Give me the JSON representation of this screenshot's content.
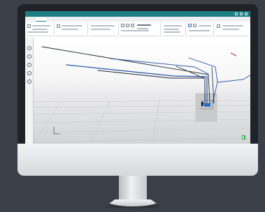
{
  "window": {
    "title": "",
    "ribbon_tabs": [
      "",
      "",
      "",
      "",
      ""
    ],
    "active_tab_index": 1
  },
  "viewport": {
    "corner_label": ""
  },
  "colors": {
    "title_bar": "#1d7e83",
    "pipe_blue": "#2255a0",
    "pipe_dark": "#1c2533",
    "pipe_red": "#d0312d",
    "connector_blue": "#2170c4",
    "status_green": "#2aa84a",
    "page_background": "#3b3f47"
  },
  "icons": {
    "sidebar": [
      "view-front-icon",
      "view-rotate-icon",
      "zoom-icon",
      "pan-icon",
      "settings-icon"
    ],
    "status": "status-green-icon",
    "axis": "axis-triad-icon"
  }
}
